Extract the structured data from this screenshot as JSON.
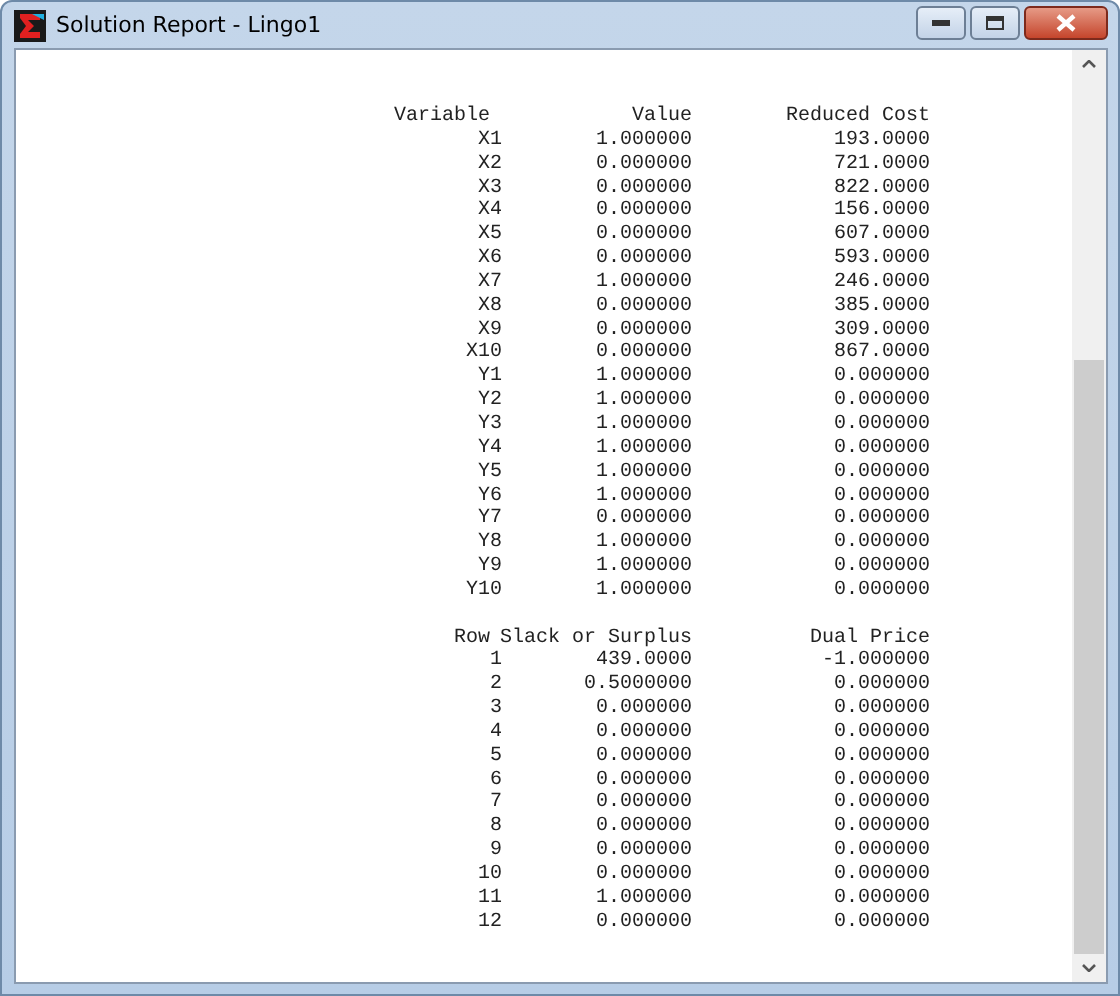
{
  "window": {
    "title": "Solution Report - Lingo1"
  },
  "tables": [
    {
      "columns": [
        "Variable",
        "Value",
        "Reduced Cost"
      ],
      "rows": [
        [
          "X1",
          "1.000000",
          "193.0000"
        ],
        [
          "X2",
          "0.000000",
          "721.0000"
        ],
        [
          "X3",
          "0.000000",
          "822.0000"
        ],
        [
          "X4",
          "0.000000",
          "156.0000"
        ],
        [
          "X5",
          "0.000000",
          "607.0000"
        ],
        [
          "X6",
          "0.000000",
          "593.0000"
        ],
        [
          "X7",
          "1.000000",
          "246.0000"
        ],
        [
          "X8",
          "0.000000",
          "385.0000"
        ],
        [
          "X9",
          "0.000000",
          "309.0000"
        ],
        [
          "X10",
          "0.000000",
          "867.0000"
        ],
        [
          "Y1",
          "1.000000",
          "0.000000"
        ],
        [
          "Y2",
          "1.000000",
          "0.000000"
        ],
        [
          "Y3",
          "1.000000",
          "0.000000"
        ],
        [
          "Y4",
          "1.000000",
          "0.000000"
        ],
        [
          "Y5",
          "1.000000",
          "0.000000"
        ],
        [
          "Y6",
          "1.000000",
          "0.000000"
        ],
        [
          "Y7",
          "0.000000",
          "0.000000"
        ],
        [
          "Y8",
          "1.000000",
          "0.000000"
        ],
        [
          "Y9",
          "1.000000",
          "0.000000"
        ],
        [
          "Y10",
          "1.000000",
          "0.000000"
        ]
      ]
    },
    {
      "columns": [
        "Row",
        "Slack or Surplus",
        "Dual Price"
      ],
      "rows": [
        [
          "1",
          "439.0000",
          "-1.000000"
        ],
        [
          "2",
          "0.5000000",
          "0.000000"
        ],
        [
          "3",
          "0.000000",
          "0.000000"
        ],
        [
          "4",
          "0.000000",
          "0.000000"
        ],
        [
          "5",
          "0.000000",
          "0.000000"
        ],
        [
          "6",
          "0.000000",
          "0.000000"
        ],
        [
          "7",
          "0.000000",
          "0.000000"
        ],
        [
          "8",
          "0.000000",
          "0.000000"
        ],
        [
          "9",
          "0.000000",
          "0.000000"
        ],
        [
          "10",
          "0.000000",
          "0.000000"
        ],
        [
          "11",
          "1.000000",
          "0.000000"
        ],
        [
          "12",
          "0.000000",
          "0.000000"
        ]
      ]
    }
  ]
}
